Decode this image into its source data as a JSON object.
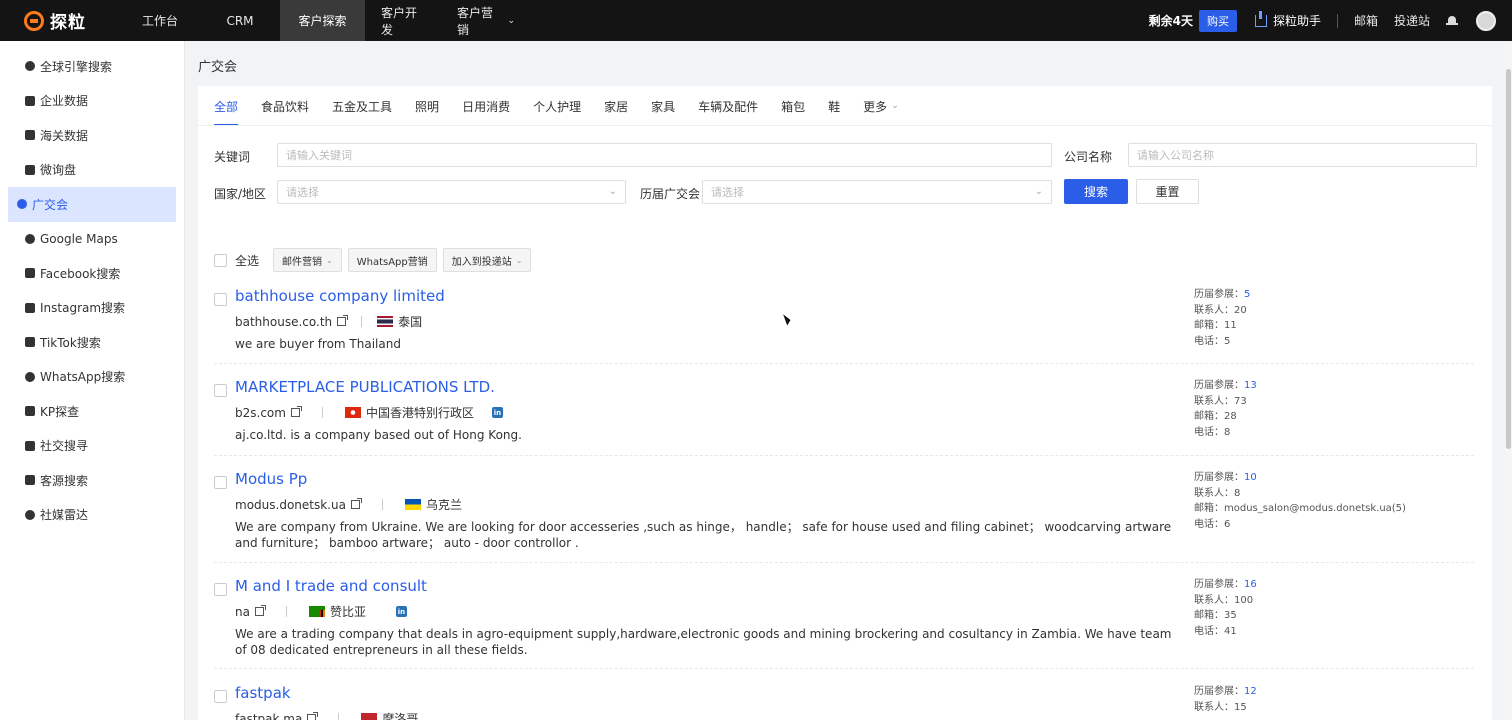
{
  "header": {
    "logo_text": "探粒",
    "nav": [
      {
        "label": "工作台"
      },
      {
        "label": "CRM"
      },
      {
        "label": "客户探索"
      },
      {
        "label": "客户开发"
      },
      {
        "label": "客户营销"
      }
    ],
    "remain": "剩余4天",
    "buy": "购买",
    "helper": "探粒助手",
    "mailbox": "邮箱",
    "delivery": "投递站"
  },
  "sidebar": {
    "items": [
      {
        "label": "全球引擎搜索"
      },
      {
        "label": "企业数据"
      },
      {
        "label": "海关数据"
      },
      {
        "label": "微询盘"
      },
      {
        "label": "广交会"
      },
      {
        "label": "Google Maps"
      },
      {
        "label": "Facebook搜索"
      },
      {
        "label": "Instagram搜索"
      },
      {
        "label": "TikTok搜索"
      },
      {
        "label": "WhatsApp搜索"
      },
      {
        "label": "KP探查"
      },
      {
        "label": "社交搜寻"
      },
      {
        "label": "客源搜索"
      },
      {
        "label": "社媒雷达"
      }
    ]
  },
  "page": {
    "title": "广交会",
    "tabs": [
      "全部",
      "食品饮料",
      "五金及工具",
      "照明",
      "日用消费",
      "个人护理",
      "家居",
      "家具",
      "车辆及配件",
      "箱包",
      "鞋",
      "更多"
    ],
    "filters": {
      "keyword_label": "关键词",
      "keyword_placeholder": "请输入关键词",
      "company_label": "公司名称",
      "company_placeholder": "请输入公司名称",
      "country_label": "国家/地区",
      "country_placeholder": "请选择",
      "session_label": "历届广交会",
      "session_placeholder": "请选择",
      "search_btn": "搜索",
      "reset_btn": "重置"
    },
    "toolbar": {
      "select_all": "全选",
      "email_marketing": "邮件营销",
      "whatsapp_marketing": "WhatsApp营销",
      "add_delivery": "加入到投递站"
    }
  },
  "results": [
    {
      "name": "bathhouse company limited",
      "domain": "bathhouse.co.th",
      "country": "泰国",
      "desc": "we are buyer from Thailand",
      "stats": {
        "sessions_label": "历届参展：",
        "sessions": "5",
        "contacts_label": "联系人：",
        "contacts": "20",
        "email_label": "邮箱：",
        "email": "11",
        "phone_label": "电话：",
        "phone": "5"
      }
    },
    {
      "name": "MARKETPLACE PUBLICATIONS LTD.",
      "domain": "b2s.com",
      "country": "中国香港特别行政区",
      "desc": "aj.co.ltd. is a company based out of Hong Kong.",
      "stats": {
        "sessions_label": "历届参展：",
        "sessions": "13",
        "contacts_label": "联系人：",
        "contacts": "73",
        "email_label": "邮箱：",
        "email": "28",
        "phone_label": "电话：",
        "phone": "8"
      }
    },
    {
      "name": "Modus Pp",
      "domain": "modus.donetsk.ua",
      "country": "乌克兰",
      "desc": "We are company from Ukraine. We are looking for door accesseries ,such as hinge， handle； safe for house used and filing cabinet； woodcarving artware and furniture； bamboo artware； auto - door controllor .",
      "stats": {
        "sessions_label": "历届参展：",
        "sessions": "10",
        "contacts_label": "联系人：",
        "contacts": "8",
        "email_label": "邮箱：",
        "email": "modus_salon@modus.donetsk.ua(5)",
        "phone_label": "电话：",
        "phone": "6"
      }
    },
    {
      "name": "M and I trade and consult",
      "domain": "na",
      "country": "赞比亚",
      "desc": "We are a trading company that deals in agro-equipment supply,hardware,electronic goods and mining brockering and cosultancy in Zambia. We have team of 08 dedicated entrepreneurs in all these fields.",
      "stats": {
        "sessions_label": "历届参展：",
        "sessions": "16",
        "contacts_label": "联系人：",
        "contacts": "100",
        "email_label": "邮箱：",
        "email": "35",
        "phone_label": "电话：",
        "phone": "41"
      }
    },
    {
      "name": "fastpak",
      "domain": "fastpak.ma",
      "country": "摩洛哥",
      "desc": "",
      "stats": {
        "sessions_label": "历届参展：",
        "sessions": "12",
        "contacts_label": "联系人：",
        "contacts": "15",
        "email_label": "",
        "email": "",
        "phone_label": "",
        "phone": ""
      }
    }
  ]
}
